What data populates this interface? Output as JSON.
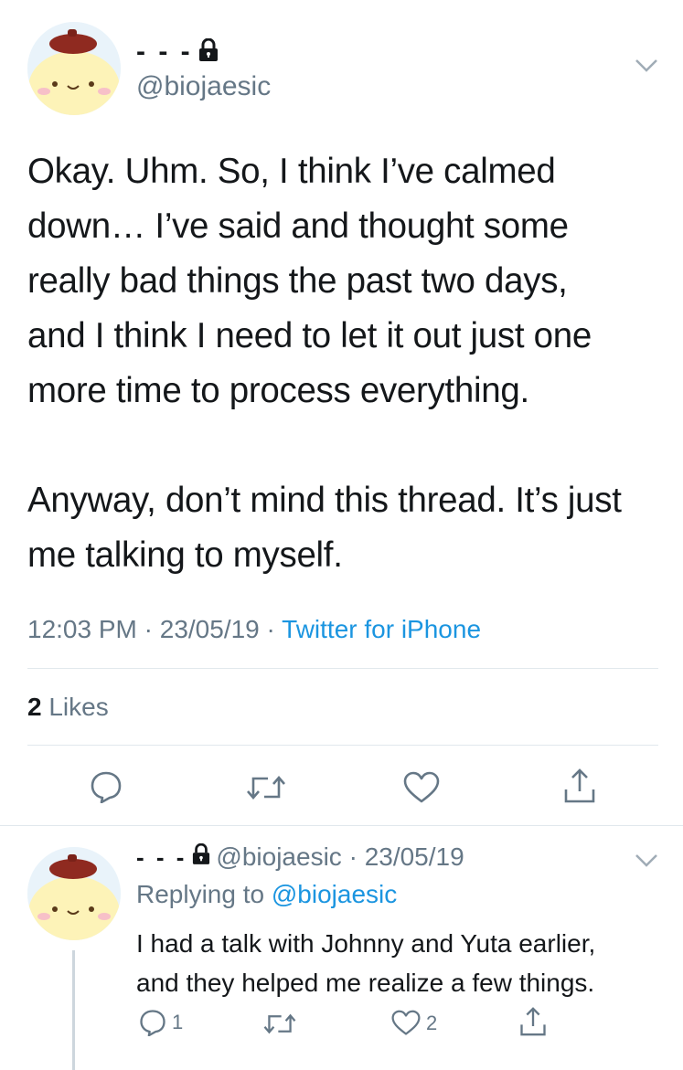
{
  "tweet": {
    "display_name": "- - -",
    "handle": "@biojaesic",
    "text": "Okay. Uhm. So, I think I’ve calmed\ndown… I’ve said and thought some\nreally bad things the past two days,\nand I think I need to let it out just one\nmore time to process everything.\n\nAnyway, don’t mind this thread. It’s just\nme talking to myself.",
    "time": "12:03 PM",
    "date": "23/05/19",
    "separator": " · ",
    "source": "Twitter for iPhone",
    "likes_count": "2",
    "likes_label": "Likes",
    "icons": [
      "lock-icon",
      "chevron-down-icon",
      "reply-icon",
      "retweet-icon",
      "like-icon",
      "share-icon"
    ]
  },
  "reply": {
    "display_name": "- - -",
    "handle": "@biojaesic",
    "date": "23/05/19",
    "separator": " · ",
    "replying_prefix": "Replying to",
    "replying_to": "@biojaesic",
    "text": "I had a talk with Johnny and Yuta earlier,\nand they helped me realize a few things.",
    "reply_count": "1",
    "like_count": "2"
  },
  "colors": {
    "text": "#14171a",
    "secondary": "#657786",
    "link": "#1b95e0",
    "divider": "#e1e8ed"
  }
}
